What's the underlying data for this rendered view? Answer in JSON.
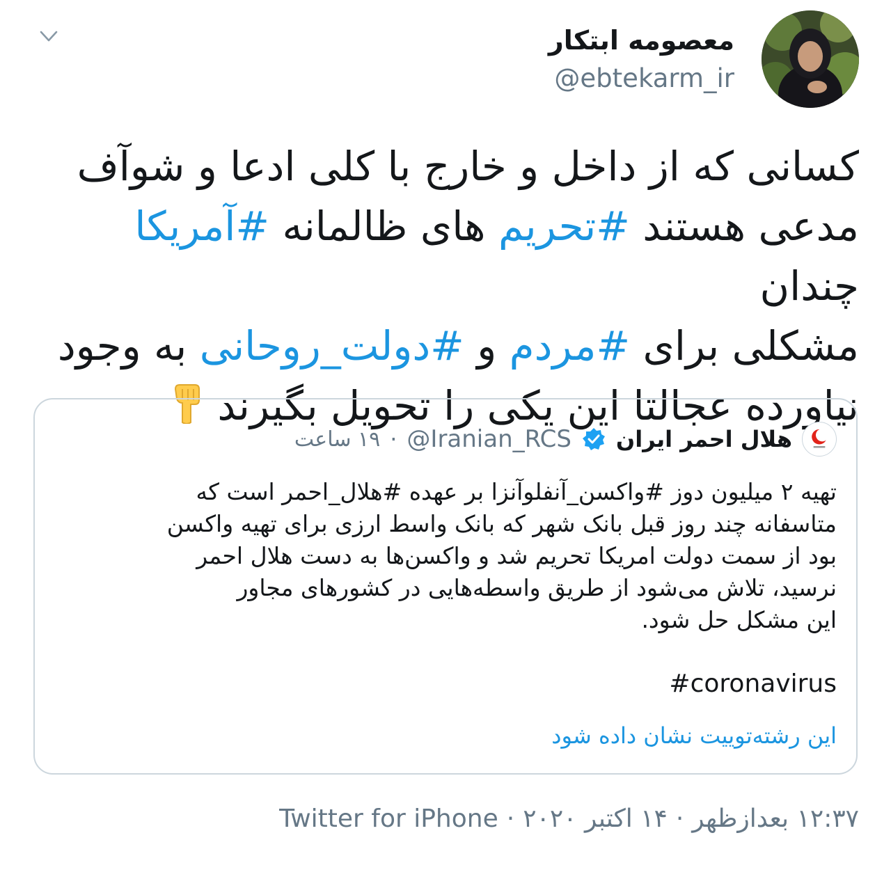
{
  "author": {
    "name": "معصومه ابتکار",
    "handle": "@ebtekarm_ir"
  },
  "tweet": {
    "line1": "کسانی که از داخل و خارج با کلی ادعا و شوآف",
    "line2_a": "مدعی هستند ",
    "line2_tag1": "#تحریم",
    "line2_b": " های ظالمانه ",
    "line2_tag2": "#آمریکا",
    "line2_c": " چندان",
    "line3_a": "مشکلی برای ",
    "line3_tag1": "#مردم",
    "line3_b": " و ",
    "line3_tag2": "#دولت_روحانی",
    "line3_c": " به وجود",
    "line4": "نیاورده عجالتا این یکی را  تحویل بگیرند "
  },
  "quoted_tweet": {
    "name": "هلال احمر ایران",
    "handle": "@Iranian_RCS",
    "separator": "·",
    "time": "۱۹ ساعت",
    "body_lines": [
      "تهیه ۲ میلیون دوز #واکسن_آنفلوآنزا بر عهده #هلال_احمر است که",
      "متاسفانه چند روز قبل بانک شهر که بانک واسط ارزی برای تهیه واکسن",
      "بود از سمت دولت امریکا تحریم شد و واکسن‌ها به دست هلال احمر",
      "نرسید، تلاش می‌شود از طریق واسطه‌هایی در کشورهای مجاور",
      "این مشکل حل شود."
    ],
    "hashtag": "#coronavirus",
    "show_thread": "این رشته‌توییت نشان داده شود"
  },
  "footer": {
    "time": "۱۲:۳۷ بعدازظهر",
    "date": "۱۴ اکتبر ۲۰۲۰",
    "source": "Twitter for iPhone",
    "separator": "·"
  },
  "colors": {
    "hashtag": "#1b95e0",
    "secondary_text": "#657786",
    "border": "#ccd6dd",
    "verified": "#1da1f2"
  },
  "icons": {
    "chevron": "chevron-down-icon",
    "emoji": "backhand-index-pointing-down-emoji",
    "verified": "verified-badge-icon"
  }
}
